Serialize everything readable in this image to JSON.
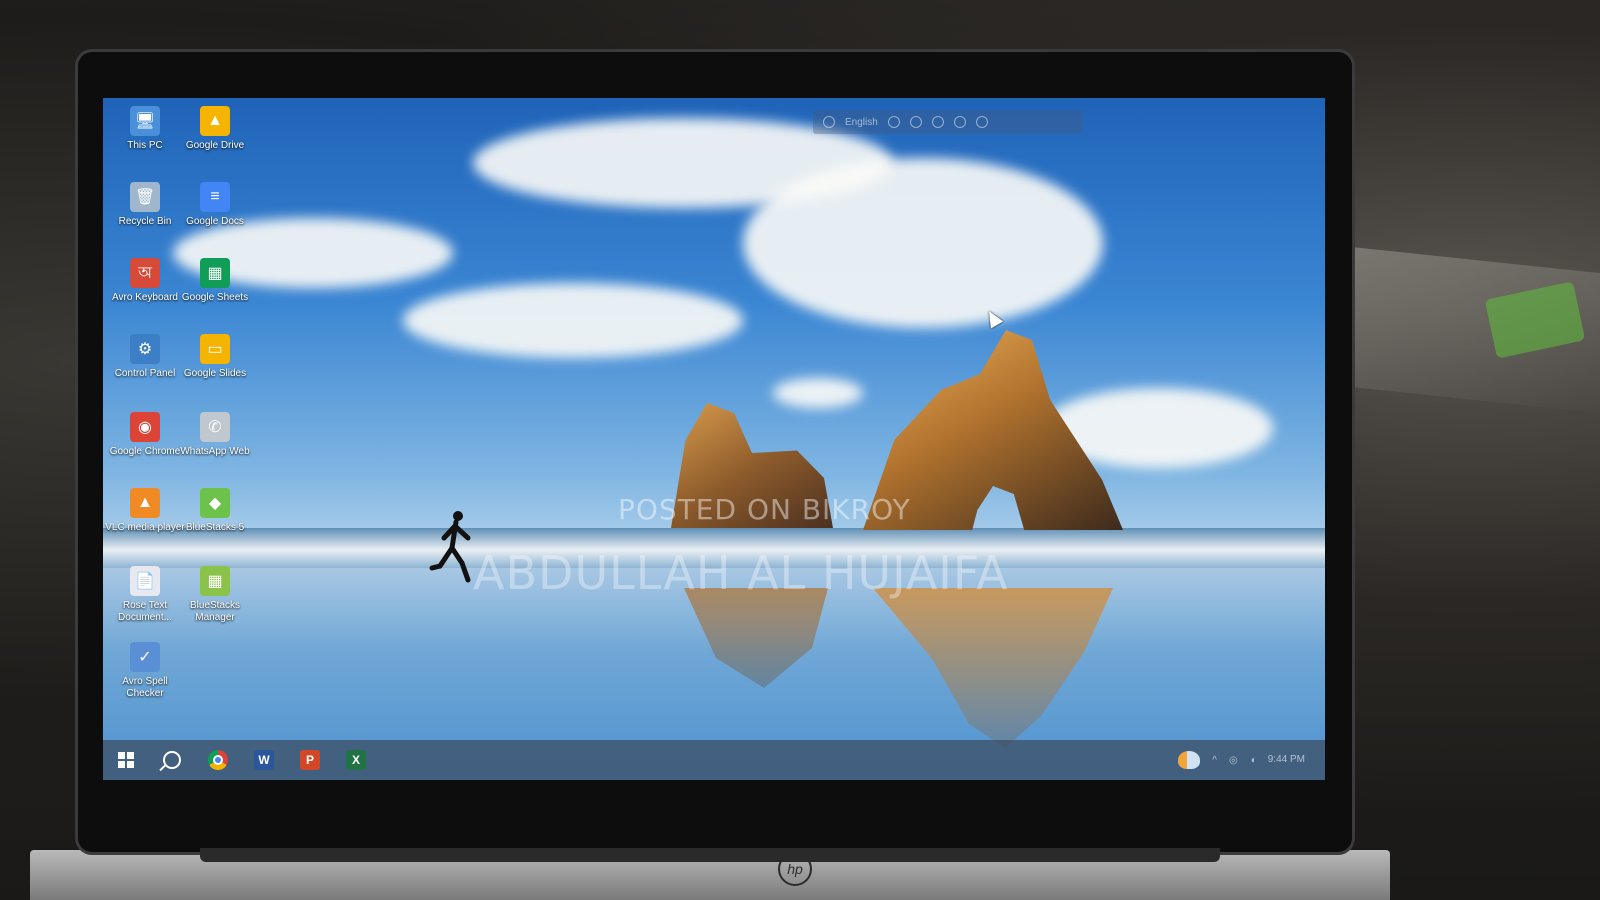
{
  "desktop_icons": [
    {
      "label": "This PC",
      "icon": "computer-icon",
      "color": "#4a90d9",
      "glyph": "🖥"
    },
    {
      "label": "Google Drive",
      "icon": "google-drive-icon",
      "color": "#f4b400",
      "glyph": "▲"
    },
    {
      "label": "Recycle Bin",
      "icon": "recycle-bin-icon",
      "color": "#9fb6cc",
      "glyph": "🗑"
    },
    {
      "label": "Google Docs",
      "icon": "google-docs-icon",
      "color": "#4285f4",
      "glyph": "≡"
    },
    {
      "label": "Avro Keyboard",
      "icon": "avro-keyboard-icon",
      "color": "#d64a3a",
      "glyph": "অ"
    },
    {
      "label": "Google Sheets",
      "icon": "google-sheets-icon",
      "color": "#0f9d58",
      "glyph": "▦"
    },
    {
      "label": "Control Panel",
      "icon": "control-panel-icon",
      "color": "#3c7fc7",
      "glyph": "⚙"
    },
    {
      "label": "Google Slides",
      "icon": "google-slides-icon",
      "color": "#f4b400",
      "glyph": "▭"
    },
    {
      "label": "Google Chrome",
      "icon": "chrome-icon",
      "color": "#db4437",
      "glyph": "◉"
    },
    {
      "label": "WhatsApp Web",
      "icon": "whatsapp-icon",
      "color": "#bfc7cf",
      "glyph": "✆"
    },
    {
      "label": "VLC media player",
      "icon": "vlc-icon",
      "color": "#f08a24",
      "glyph": "▲"
    },
    {
      "label": "BlueStacks 5",
      "icon": "bluestacks-icon",
      "color": "#6cc24a",
      "glyph": "◆"
    },
    {
      "label": "Rose Text Document...",
      "icon": "text-document-icon",
      "color": "#e8e8f0",
      "glyph": "📄"
    },
    {
      "label": "BlueStacks Manager",
      "icon": "bluestacks-manager-icon",
      "color": "#8bc34a",
      "glyph": "▦"
    },
    {
      "label": "Avro Spell Checker",
      "icon": "spell-checker-icon",
      "color": "#5a8fd6",
      "glyph": "✓"
    }
  ],
  "floatbar": {
    "label": "English"
  },
  "watermark": {
    "line1": "POSTED ON BIKROY",
    "line2": "ABDULLAH AL HUJAIFA"
  },
  "taskbar": {
    "apps": [
      {
        "name": "Google Chrome",
        "icon": "chrome-icon"
      },
      {
        "name": "Word",
        "icon": "word-icon",
        "letter": "W",
        "color": "#2b579a"
      },
      {
        "name": "PowerPoint",
        "icon": "powerpoint-icon",
        "letter": "P",
        "color": "#d24726"
      },
      {
        "name": "Excel",
        "icon": "excel-icon",
        "letter": "X",
        "color": "#217346"
      }
    ],
    "tray": {
      "chevron": "^",
      "time": "9:44 PM"
    }
  }
}
